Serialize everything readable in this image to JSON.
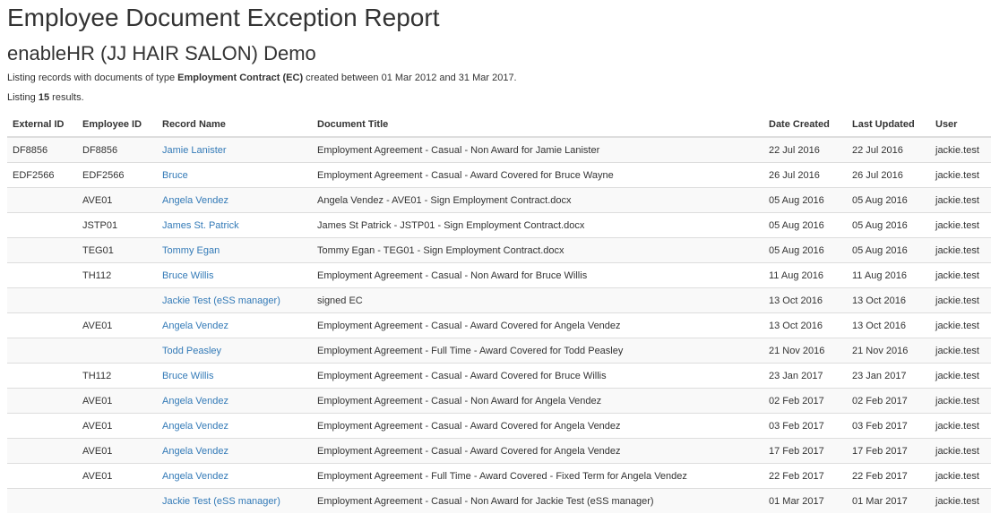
{
  "header": {
    "title": "Employee Document Exception Report",
    "subtitle": "enableHR (JJ HAIR SALON) Demo"
  },
  "summary": {
    "line1_prefix": "Listing records with documents of type ",
    "document_type": "Employment Contract (EC)",
    "line1_suffix": " created between 01 Mar 2012 and 31 Mar 2017.",
    "line2_prefix": "Listing ",
    "count": "15",
    "line2_suffix": " results."
  },
  "table": {
    "columns": [
      "External ID",
      "Employee ID",
      "Record Name",
      "Document Title",
      "Date Created",
      "Last Updated",
      "User"
    ],
    "rows": [
      {
        "external_id": "DF8856",
        "employee_id": "DF8856",
        "record_name": "Jamie Lanister",
        "document_title": "Employment Agreement - Casual - Non Award for Jamie Lanister",
        "date_created": "22 Jul 2016",
        "last_updated": "22 Jul 2016",
        "user": "jackie.test"
      },
      {
        "external_id": "EDF2566",
        "employee_id": "EDF2566",
        "record_name": "Bruce",
        "document_title": "Employment Agreement - Casual - Award Covered for Bruce Wayne",
        "date_created": "26 Jul 2016",
        "last_updated": "26 Jul 2016",
        "user": "jackie.test"
      },
      {
        "external_id": "",
        "employee_id": "AVE01",
        "record_name": "Angela Vendez",
        "document_title": "Angela Vendez - AVE01 - Sign Employment Contract.docx",
        "date_created": "05 Aug 2016",
        "last_updated": "05 Aug 2016",
        "user": "jackie.test"
      },
      {
        "external_id": "",
        "employee_id": "JSTP01",
        "record_name": "James St. Patrick",
        "document_title": "James St Patrick - JSTP01 - Sign Employment Contract.docx",
        "date_created": "05 Aug 2016",
        "last_updated": "05 Aug 2016",
        "user": "jackie.test"
      },
      {
        "external_id": "",
        "employee_id": "TEG01",
        "record_name": "Tommy Egan",
        "document_title": "Tommy Egan - TEG01 - Sign Employment Contract.docx",
        "date_created": "05 Aug 2016",
        "last_updated": "05 Aug 2016",
        "user": "jackie.test"
      },
      {
        "external_id": "",
        "employee_id": "TH112",
        "record_name": "Bruce Willis",
        "document_title": "Employment Agreement - Casual - Non Award for Bruce Willis",
        "date_created": "11 Aug 2016",
        "last_updated": "11 Aug 2016",
        "user": "jackie.test"
      },
      {
        "external_id": "",
        "employee_id": "",
        "record_name": "Jackie Test (eSS manager)",
        "document_title": "signed EC",
        "date_created": "13 Oct 2016",
        "last_updated": "13 Oct 2016",
        "user": "jackie.test"
      },
      {
        "external_id": "",
        "employee_id": "AVE01",
        "record_name": "Angela Vendez",
        "document_title": "Employment Agreement - Casual - Award Covered for Angela Vendez",
        "date_created": "13 Oct 2016",
        "last_updated": "13 Oct 2016",
        "user": "jackie.test"
      },
      {
        "external_id": "",
        "employee_id": "",
        "record_name": "Todd Peasley",
        "document_title": "Employment Agreement - Full Time - Award Covered for Todd Peasley",
        "date_created": "21 Nov 2016",
        "last_updated": "21 Nov 2016",
        "user": "jackie.test"
      },
      {
        "external_id": "",
        "employee_id": "TH112",
        "record_name": "Bruce Willis",
        "document_title": "Employment Agreement - Casual - Award Covered for Bruce Willis",
        "date_created": "23 Jan 2017",
        "last_updated": "23 Jan 2017",
        "user": "jackie.test"
      },
      {
        "external_id": "",
        "employee_id": "AVE01",
        "record_name": "Angela Vendez",
        "document_title": "Employment Agreement - Casual - Non Award for Angela Vendez",
        "date_created": "02 Feb 2017",
        "last_updated": "02 Feb 2017",
        "user": "jackie.test"
      },
      {
        "external_id": "",
        "employee_id": "AVE01",
        "record_name": "Angela Vendez",
        "document_title": "Employment Agreement - Casual - Award Covered for Angela Vendez",
        "date_created": "03 Feb 2017",
        "last_updated": "03 Feb 2017",
        "user": "jackie.test"
      },
      {
        "external_id": "",
        "employee_id": "AVE01",
        "record_name": "Angela Vendez",
        "document_title": "Employment Agreement - Casual - Award Covered for Angela Vendez",
        "date_created": "17 Feb 2017",
        "last_updated": "17 Feb 2017",
        "user": "jackie.test"
      },
      {
        "external_id": "",
        "employee_id": "AVE01",
        "record_name": "Angela Vendez",
        "document_title": "Employment Agreement - Full Time - Award Covered - Fixed Term for Angela Vendez",
        "date_created": "22 Feb 2017",
        "last_updated": "22 Feb 2017",
        "user": "jackie.test"
      },
      {
        "external_id": "",
        "employee_id": "",
        "record_name": "Jackie Test (eSS manager)",
        "document_title": "Employment Agreement - Casual - Non Award for Jackie Test (eSS manager)",
        "date_created": "01 Mar 2017",
        "last_updated": "01 Mar 2017",
        "user": "jackie.test"
      }
    ]
  },
  "colors": {
    "link": "#337ab7",
    "text": "#333333",
    "stripe": "#f9f9f9",
    "border": "#dddddd"
  }
}
